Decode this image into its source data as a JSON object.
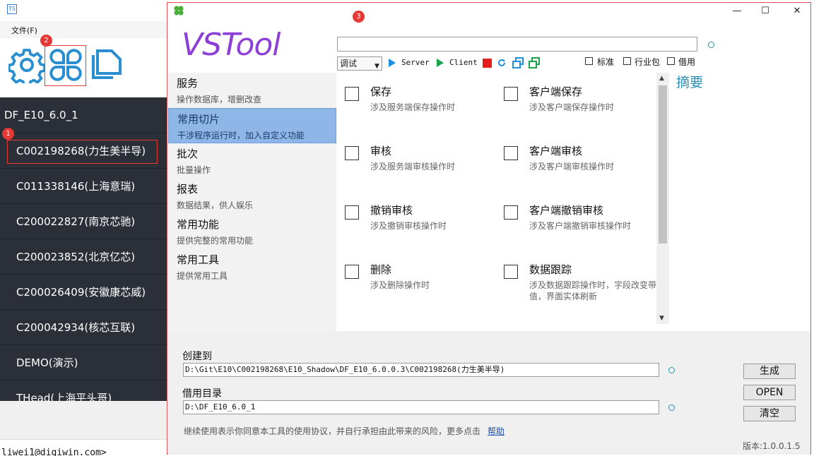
{
  "background_app": {
    "menu_file": "文件(F)",
    "list_header": "DF_E10_6.0_1",
    "items": [
      "C002198268(力生美半导)",
      "C011338146(上海意瑞)",
      "C200022827(南京芯驰)",
      "C200023852(北京亿芯)",
      "C200026409(安徽康芯威)",
      "C200042934(核芯互联)",
      "DEMO(演示)",
      "THead(上海平头哥)"
    ],
    "status_text": "liwei1@digiwin.com>",
    "badges": [
      "1",
      "2",
      "3"
    ]
  },
  "window": {
    "brand": "VSTool",
    "controls": {
      "minimize": "—",
      "maximize": "☐",
      "close": "✕"
    },
    "top_input_value": "",
    "mode_select": "调试",
    "run_server_label": "Server",
    "run_client_label": "Client",
    "checkboxes": {
      "standard": "标准",
      "industry": "行业包",
      "borrow": "借用"
    },
    "categories": [
      {
        "title": "服务",
        "desc": "操作数据库，增删改查"
      },
      {
        "title": "常用切片",
        "desc": "干涉程序运行时，加入自定义功能"
      },
      {
        "title": "批次",
        "desc": "批量操作"
      },
      {
        "title": "报表",
        "desc": "数据结果，供人娱乐"
      },
      {
        "title": "常用功能",
        "desc": "提供完整的常用功能"
      },
      {
        "title": "常用工具",
        "desc": "提供常用工具"
      }
    ],
    "selected_category": "常用切片",
    "options": [
      {
        "title": "保存",
        "desc": "涉及服务端保存操作时"
      },
      {
        "title": "客户端保存",
        "desc": "涉及客户端保存操作时"
      },
      {
        "title": "审核",
        "desc": "涉及服务端审核操作时"
      },
      {
        "title": "客户端审核",
        "desc": "涉及客户端审核操作时"
      },
      {
        "title": "撤销审核",
        "desc": "涉及撤销审核操作时"
      },
      {
        "title": "客户端撤销审核",
        "desc": "涉及客户端撤销审核操作时"
      },
      {
        "title": "删除",
        "desc": "涉及删除操作时"
      },
      {
        "title": "数据跟踪",
        "desc": "涉及数据跟踪操作时，字段改变带值，界面实体刷新"
      }
    ],
    "summary_title": "摘要",
    "create_to_label": "创建到",
    "create_to_value": "D:\\Git\\E10\\C002198268\\E10_Shadow\\DF_E10_6.0.0.3\\C002198268(力生美半导)",
    "borrow_dir_label": "借用目录",
    "borrow_dir_value": "D:\\DF_E10_6.0_1",
    "buttons": {
      "generate": "生成",
      "open": "OPEN",
      "clear": "清空"
    },
    "notice": "继续使用表示你同意本工具的使用协议，并自行承担由此带来的风险，更多点击",
    "help_link": "帮助",
    "version": "版本:1.0.0.1.5"
  },
  "colors": {
    "brand": "#8d3fd6",
    "accent": "#2a8fb4",
    "sidebar_dark": "#2b3038",
    "selection": "#8eb6e6",
    "badge_red": "#e53935"
  }
}
